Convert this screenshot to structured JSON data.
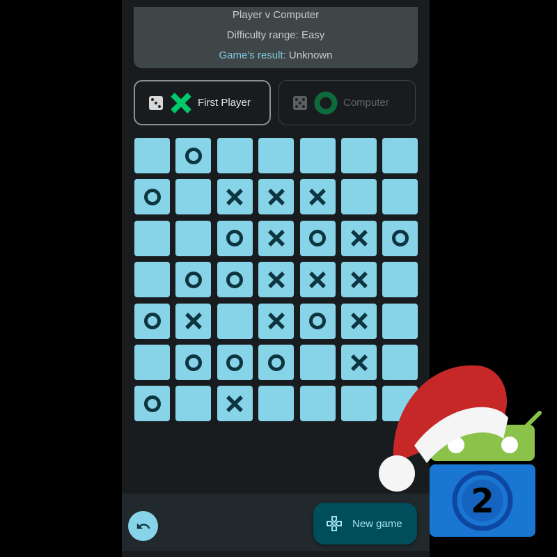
{
  "info": {
    "mode": "Player v Computer",
    "difficulty": "Difficulty range: Easy",
    "result_label": "Game's result:",
    "result_value": "Unknown"
  },
  "players": [
    {
      "name": "First Player",
      "mark": "X",
      "active": true,
      "icon": "dice-icon",
      "color": "#00c96b"
    },
    {
      "name": "Computer",
      "mark": "O",
      "active": false,
      "icon": "dice-icon",
      "color": "#0d6b3c"
    }
  ],
  "board": [
    [
      "",
      "O",
      "",
      "",
      "",
      "",
      ""
    ],
    [
      "O",
      "",
      "X",
      "X",
      "X",
      "",
      ""
    ],
    [
      "",
      "",
      "O",
      "X",
      "O",
      "X",
      "O"
    ],
    [
      "",
      "O",
      "O",
      "X",
      "X",
      "X",
      ""
    ],
    [
      "O",
      "X",
      "",
      "X",
      "O",
      "X",
      ""
    ],
    [
      "",
      "O",
      "O",
      "O",
      "",
      "X",
      ""
    ],
    [
      "O",
      "",
      "X",
      "",
      "",
      "",
      ""
    ]
  ],
  "colors": {
    "cell": "#87d3e8",
    "mark": "#0d3540",
    "background": "#191c1e"
  },
  "bottom": {
    "undo_icon": "undo-icon",
    "new_game_label": "New game",
    "new_game_icon": "gamepad-icon"
  },
  "overlay": {
    "logo": "F-Droid logo with santa hat",
    "badge": "2"
  }
}
